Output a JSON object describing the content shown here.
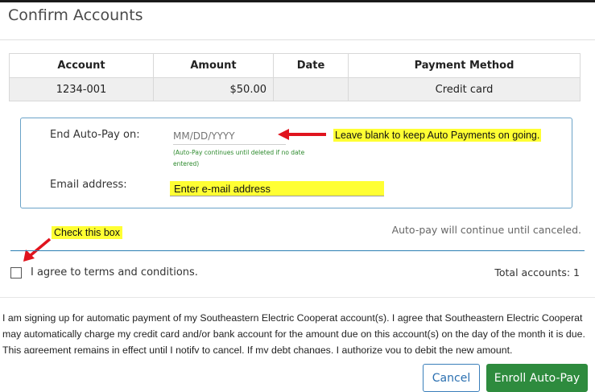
{
  "dialog": {
    "title": "Confirm Accounts"
  },
  "table": {
    "headers": [
      "Account",
      "Amount",
      "Date",
      "Payment Method"
    ],
    "rows": [
      {
        "account": "1234-001",
        "amount": "$50.00",
        "date": "",
        "method": "Credit card"
      }
    ]
  },
  "form": {
    "end_label": "End Auto-Pay on:",
    "end_placeholder": "MM/DD/YYYY",
    "end_hint": "(Auto-Pay continues until deleted if no date entered)",
    "email_label": "Email address:",
    "email_value": "Enter e-mail address"
  },
  "annotations": {
    "blank_note": "Leave blank to keep Auto Payments on going.",
    "check_note": "Check this box",
    "arrow_color": "#e0141e",
    "highlight_color": "#ffff33"
  },
  "status": {
    "autopay_note": "Auto-pay will continue until canceled.",
    "agree_label": "I agree to terms and conditions.",
    "total_label": "Total accounts: 1",
    "agree_checked": false
  },
  "terms": {
    "text": "I am signing up for automatic payment of my Southeastern Electric Cooperat account(s). I agree that Southeastern Electric Cooperat may automatically charge my credit card and/or bank account for the amount due on this account(s) on the day of the month it is due. This agreement remains in effect until I notify to cancel. If my debt changes, I authorize you to debit the new amount."
  },
  "buttons": {
    "cancel": "Cancel",
    "enroll": "Enroll Auto-Pay"
  }
}
